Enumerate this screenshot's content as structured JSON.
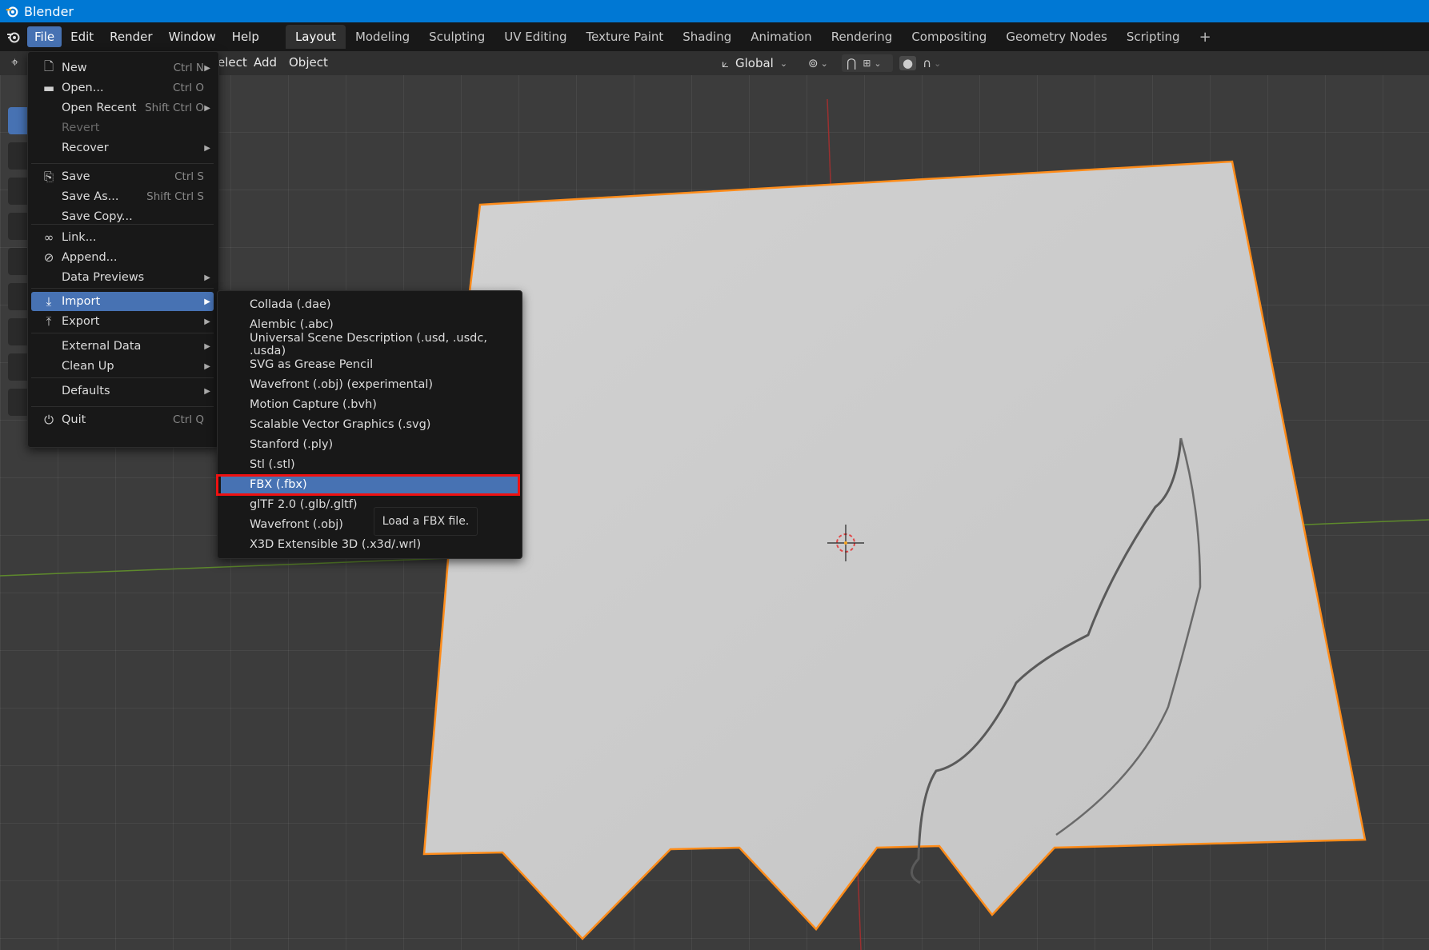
{
  "window": {
    "title": "Blender"
  },
  "menubar": {
    "items": [
      "File",
      "Edit",
      "Render",
      "Window",
      "Help"
    ],
    "tabs": [
      "Layout",
      "Modeling",
      "Sculpting",
      "UV Editing",
      "Texture Paint",
      "Shading",
      "Animation",
      "Rendering",
      "Compositing",
      "Geometry Nodes",
      "Scripting"
    ],
    "add_tab": "+"
  },
  "viewport_header": {
    "menus": [
      "elect",
      "Add",
      "Object"
    ],
    "orientation": "Global"
  },
  "file_menu": {
    "items": [
      {
        "label": "New",
        "shortcut": "Ctrl N",
        "icon": "new-file-icon",
        "submenu": true
      },
      {
        "label": "Open...",
        "shortcut": "Ctrl O",
        "icon": "folder-icon"
      },
      {
        "label": "Open Recent",
        "shortcut": "Shift Ctrl O",
        "submenu": true
      },
      {
        "label": "Revert",
        "disabled": true
      },
      {
        "label": "Recover",
        "submenu": true
      },
      {
        "label": "Save",
        "shortcut": "Ctrl S",
        "icon": "save-icon"
      },
      {
        "label": "Save As...",
        "shortcut": "Shift Ctrl S"
      },
      {
        "label": "Save Copy..."
      },
      {
        "label": "Link...",
        "icon": "link-icon"
      },
      {
        "label": "Append...",
        "icon": "append-icon"
      },
      {
        "label": "Data Previews",
        "submenu": true
      },
      {
        "label": "Import",
        "icon": "import-icon",
        "submenu": true,
        "highlighted": true
      },
      {
        "label": "Export",
        "icon": "export-icon",
        "submenu": true
      },
      {
        "label": "External Data",
        "submenu": true
      },
      {
        "label": "Clean Up",
        "submenu": true
      },
      {
        "label": "Defaults",
        "submenu": true
      },
      {
        "label": "Quit",
        "shortcut": "Ctrl Q",
        "icon": "power-icon"
      }
    ]
  },
  "import_submenu": {
    "items": [
      "Collada (.dae)",
      "Alembic (.abc)",
      "Universal Scene Description (.usd, .usdc, .usda)",
      "SVG as Grease Pencil",
      "Wavefront (.obj) (experimental)",
      "Motion Capture (.bvh)",
      "Scalable Vector Graphics (.svg)",
      "Stanford (.ply)",
      "Stl (.stl)",
      "FBX (.fbx)",
      "glTF 2.0 (.glb/.gltf)",
      "Wavefront (.obj)",
      "X3D Extensible 3D (.x3d/.wrl)"
    ],
    "highlighted": "FBX (.fbx)"
  },
  "tooltip": "Load a FBX file.",
  "colors": {
    "titlebar": "#0078d4",
    "highlight": "#4772b3",
    "selection_outline": "#ff8c1a",
    "annotation_box": "#ee1111"
  }
}
